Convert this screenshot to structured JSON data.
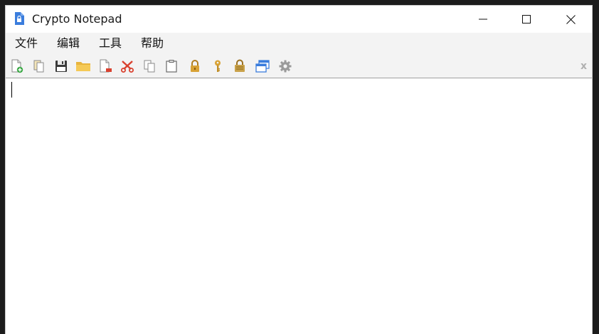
{
  "window": {
    "title": "Crypto Notepad"
  },
  "menubar": {
    "items": [
      {
        "id": "file",
        "label": "文件"
      },
      {
        "id": "edit",
        "label": "编辑"
      },
      {
        "id": "tools",
        "label": "工具"
      },
      {
        "id": "help",
        "label": "帮助"
      }
    ]
  },
  "toolbar": {
    "icons": [
      "new-file-icon",
      "copy-file-icon",
      "save-icon",
      "open-folder-icon",
      "export-file-icon",
      "cut-icon",
      "copy-icon",
      "paste-icon",
      "lock-icon",
      "key-icon",
      "encrypt-icon",
      "windows-icon",
      "gear-icon"
    ],
    "close_label": "x"
  },
  "editor": {
    "content": ""
  },
  "colors": {
    "menubar_bg": "#f3f3f3",
    "window_bg": "#ffffff",
    "accent_blue": "#3b7ddd",
    "accent_red": "#d9412f",
    "accent_gold": "#d8a235",
    "accent_green": "#3aa845"
  }
}
